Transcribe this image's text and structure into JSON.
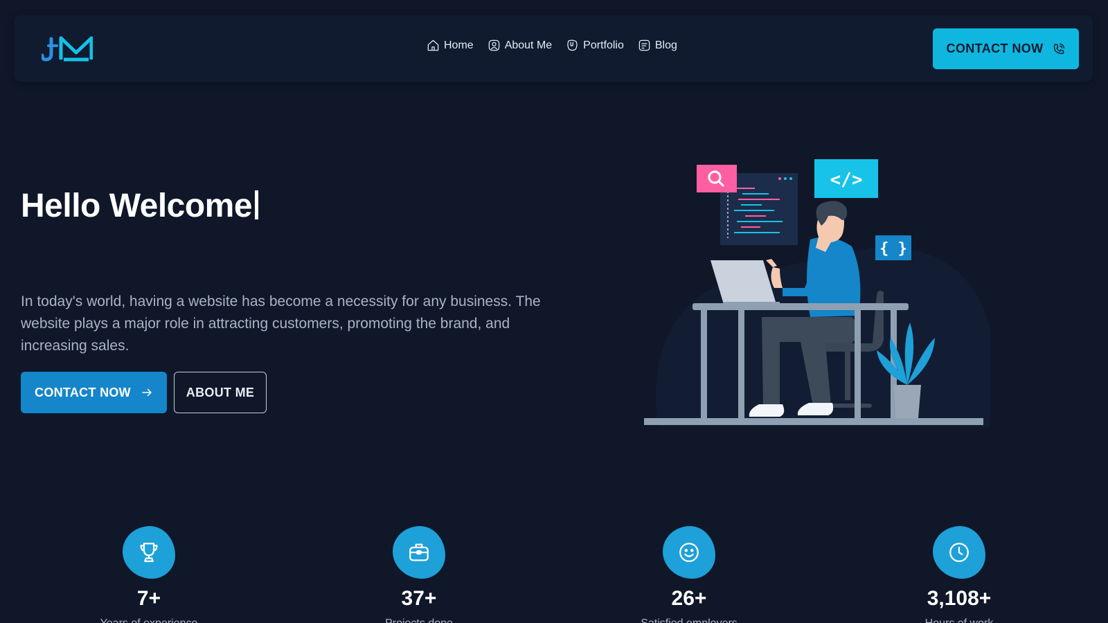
{
  "header": {
    "logo_text": "JM",
    "nav": [
      {
        "label": "Home",
        "icon": "home-icon"
      },
      {
        "label": "About Me",
        "icon": "user-icon"
      },
      {
        "label": "Portfolio",
        "icon": "portfolio-icon"
      },
      {
        "label": "Blog",
        "icon": "blog-icon"
      }
    ],
    "contact_label": "CONTACT NOW"
  },
  "hero": {
    "title": "Hello Welcome",
    "text": "In today's world, having a website has become a necessity for any business. The website plays a major role in attracting customers, promoting the brand, and increasing sales.",
    "contact_label": "CONTACT NOW",
    "about_label": "ABOUT ME",
    "illustration": {
      "search_icon": "search-icon",
      "code_tag": "</>",
      "braces": "{ }"
    }
  },
  "stats": [
    {
      "value": "7+",
      "label": "Years of experience",
      "icon": "trophy-icon"
    },
    {
      "value": "37+",
      "label": "Projects done",
      "icon": "briefcase-icon"
    },
    {
      "value": "26+",
      "label": "Satisfied employers",
      "icon": "smile-icon"
    },
    {
      "value": "3,108+",
      "label": "Hours of work",
      "icon": "clock-icon"
    }
  ],
  "colors": {
    "background": "#0f1729",
    "header_bg": "#111b30",
    "accent_cyan": "#0fb7e0",
    "accent_blue": "#1486c9",
    "stat_icon_bg": "#1ea0d8",
    "muted_text": "#a9b4c6"
  }
}
